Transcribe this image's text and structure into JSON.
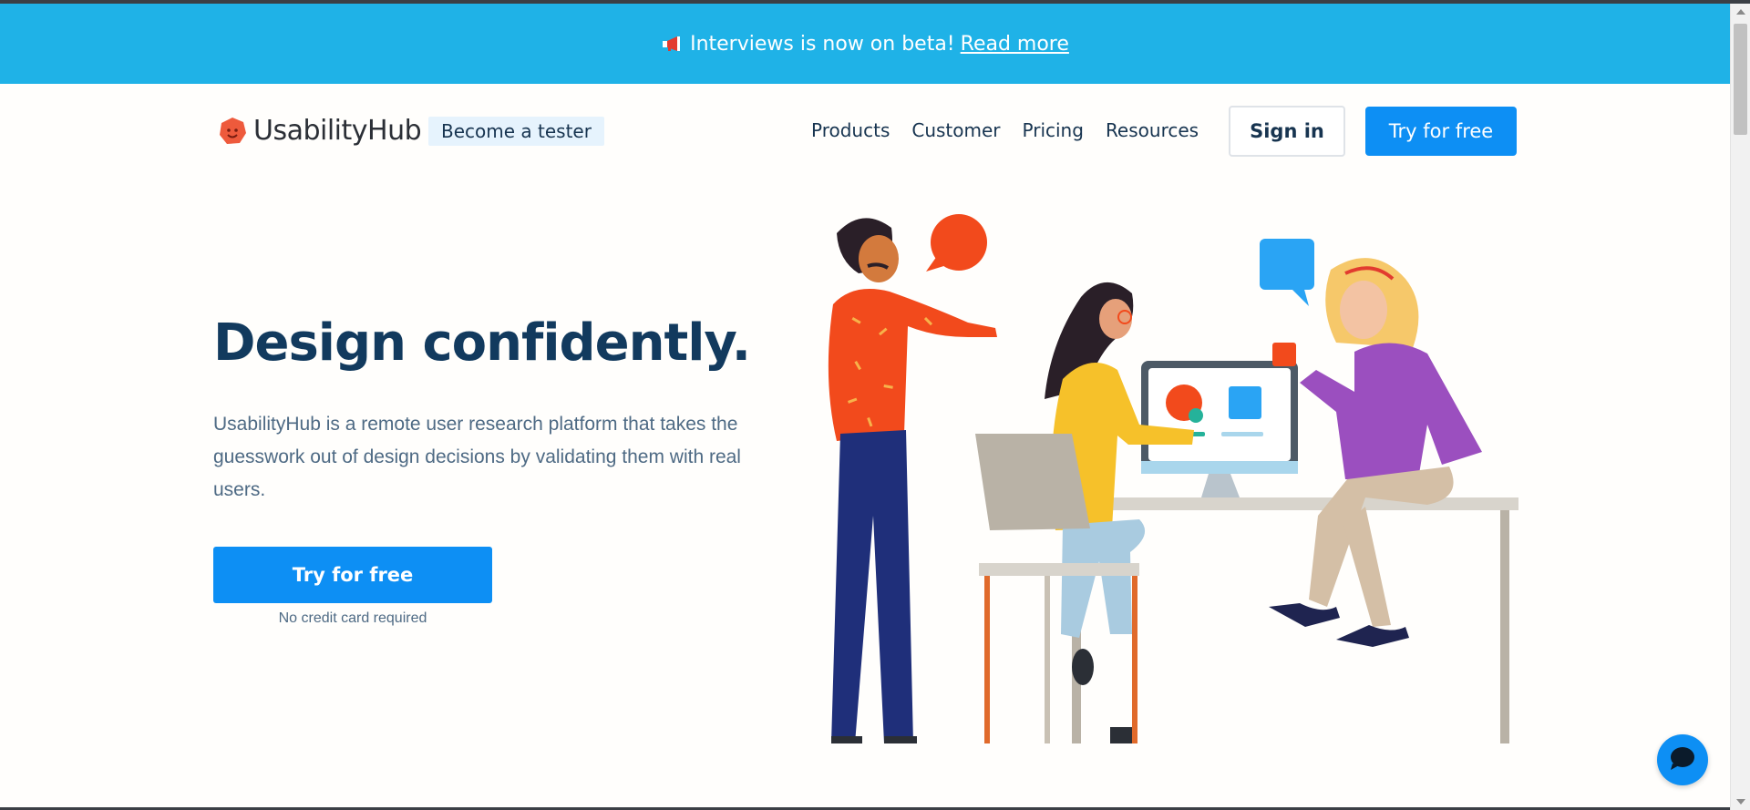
{
  "banner": {
    "icon": "megaphone-icon",
    "text": "Interviews is now on beta!",
    "link": "Read more",
    "bg_color": "#1fb2e7"
  },
  "nav": {
    "brand": "UsabilityHub",
    "logo_icon": "usabilityhub-logo-icon",
    "tester_label": "Become a tester",
    "links": [
      "Products",
      "Customer",
      "Pricing",
      "Resources"
    ],
    "signin_label": "Sign in",
    "try_label": "Try for free"
  },
  "hero": {
    "title": "Design confidently.",
    "description": "UsabilityHub is a remote user research platform that takes the guesswork out of design decisions by validating them with real users.",
    "cta_label": "Try for free",
    "cta_note": "No credit card required"
  },
  "chat_widget": {
    "icon": "chat-bubble-icon"
  },
  "colors": {
    "accent": "#0d8ff4",
    "heading": "#123a5e",
    "body_text": "#4e6a84",
    "brand_orange": "#ee5a3c"
  }
}
